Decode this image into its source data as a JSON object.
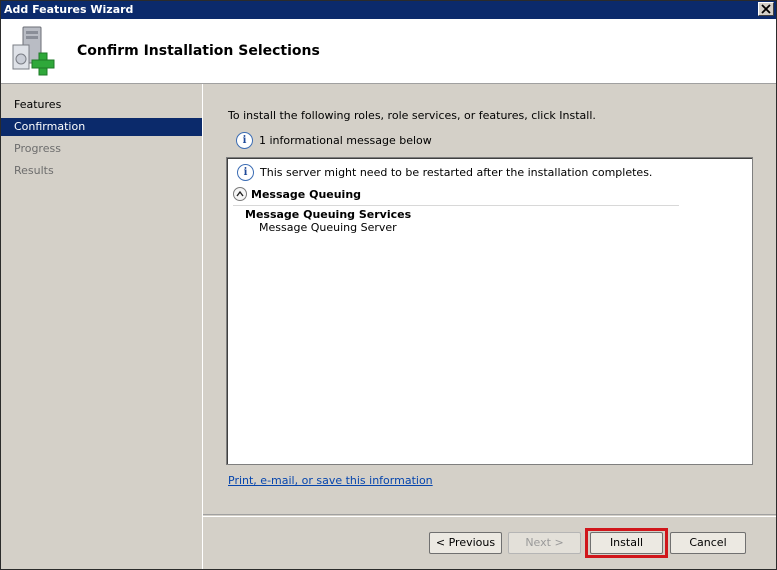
{
  "window": {
    "title": "Add Features Wizard"
  },
  "header": {
    "title": "Confirm Installation Selections"
  },
  "sidebar": {
    "items": [
      {
        "label": "Features",
        "state": "normal"
      },
      {
        "label": "Confirmation",
        "state": "active"
      },
      {
        "label": "Progress",
        "state": "disabled"
      },
      {
        "label": "Results",
        "state": "disabled"
      }
    ]
  },
  "main": {
    "instructions": "To install the following roles, role services, or features, click Install.",
    "info_message": "1 informational message below",
    "restart_warning": "This server might need to be restarted after the installation completes.",
    "section_title": "Message Queuing",
    "feature_title": "Message Queuing Services",
    "feature_sub": "Message Queuing Server",
    "print_link": "Print, e-mail, or save this information"
  },
  "buttons": {
    "previous": "< Previous",
    "next": "Next >",
    "install": "Install",
    "cancel": "Cancel"
  },
  "icons": {
    "info": "info-icon",
    "close": "close-icon",
    "collapse": "chevron-up-icon",
    "wizard": "server-add-icon"
  },
  "colors": {
    "titlebar": "#0b2a6b",
    "selected": "#0b2a6b",
    "highlight": "#d0161b",
    "link": "#0645ad"
  }
}
